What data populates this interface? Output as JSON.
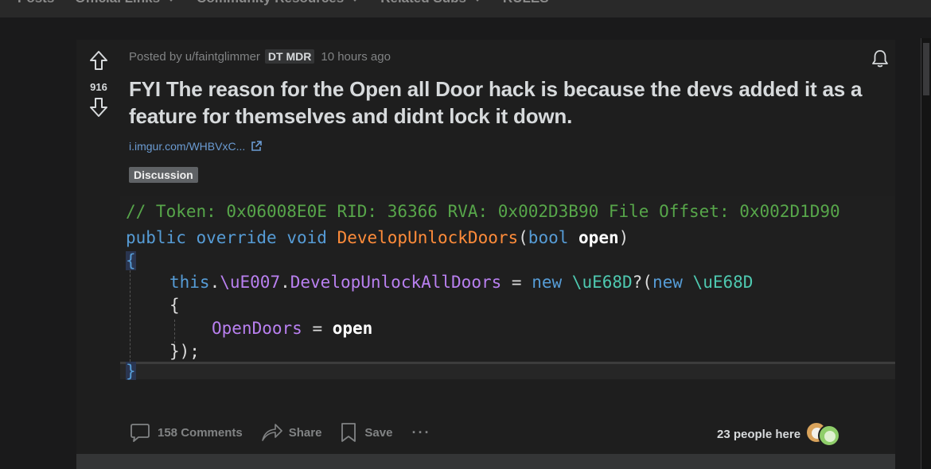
{
  "topnav": {
    "items": [
      {
        "label": "Posts",
        "caret": false
      },
      {
        "label": "Official Links",
        "caret": true
      },
      {
        "label": "Community Resources",
        "caret": true
      },
      {
        "label": "Related Subs",
        "caret": true
      },
      {
        "label": "RULES",
        "caret": false
      }
    ]
  },
  "post": {
    "votes": "916",
    "posted_by": "Posted by",
    "username": "u/faintglimmer",
    "user_flair": "DT MDR",
    "time": "10 hours ago",
    "title": "FYI The reason for the Open all Door hack is because the devs added it as a feature for themselves and didnt lock it down.",
    "link_text": "i.imgur.com/WHBVxC...",
    "flair": "Discussion",
    "code": {
      "comment": "// Token: 0x06008E0E RID: 36366 RVA: 0x002D3B90 File Offset: 0x002D1D90",
      "kw_public": "public",
      "kw_override": "override",
      "kw_void": "void",
      "method": "DevelopUnlockDoors",
      "paren_open": "(",
      "kw_bool": "bool",
      "param": "open",
      "paren_close": ")",
      "brace_open": "{",
      "this_kw": "this",
      "dot1": ".",
      "field_ue007": "\\uE007",
      "dot2": ".",
      "prop_develop": "DevelopUnlockAllDoors",
      "assign": " = ",
      "kw_new1": "new",
      "type_ue68d": "\\uE68D",
      "q_paren": "?(",
      "kw_new2": "new",
      "type_ue68d2": "\\uE68D",
      "inner_brace_open": "{",
      "prop_opendoors": "OpenDoors",
      "assign2": " = ",
      "value_open": "open",
      "inner_close": "});",
      "brace_close": "}"
    },
    "actions": {
      "comments": "158 Comments",
      "share": "Share",
      "save": "Save",
      "more": "···"
    },
    "people_here": "23 people here"
  },
  "colors": {
    "background": "#1a1a1b",
    "card": "#1e1e1e",
    "link": "#6b9bd2",
    "flair_bg": "#5f6265"
  }
}
